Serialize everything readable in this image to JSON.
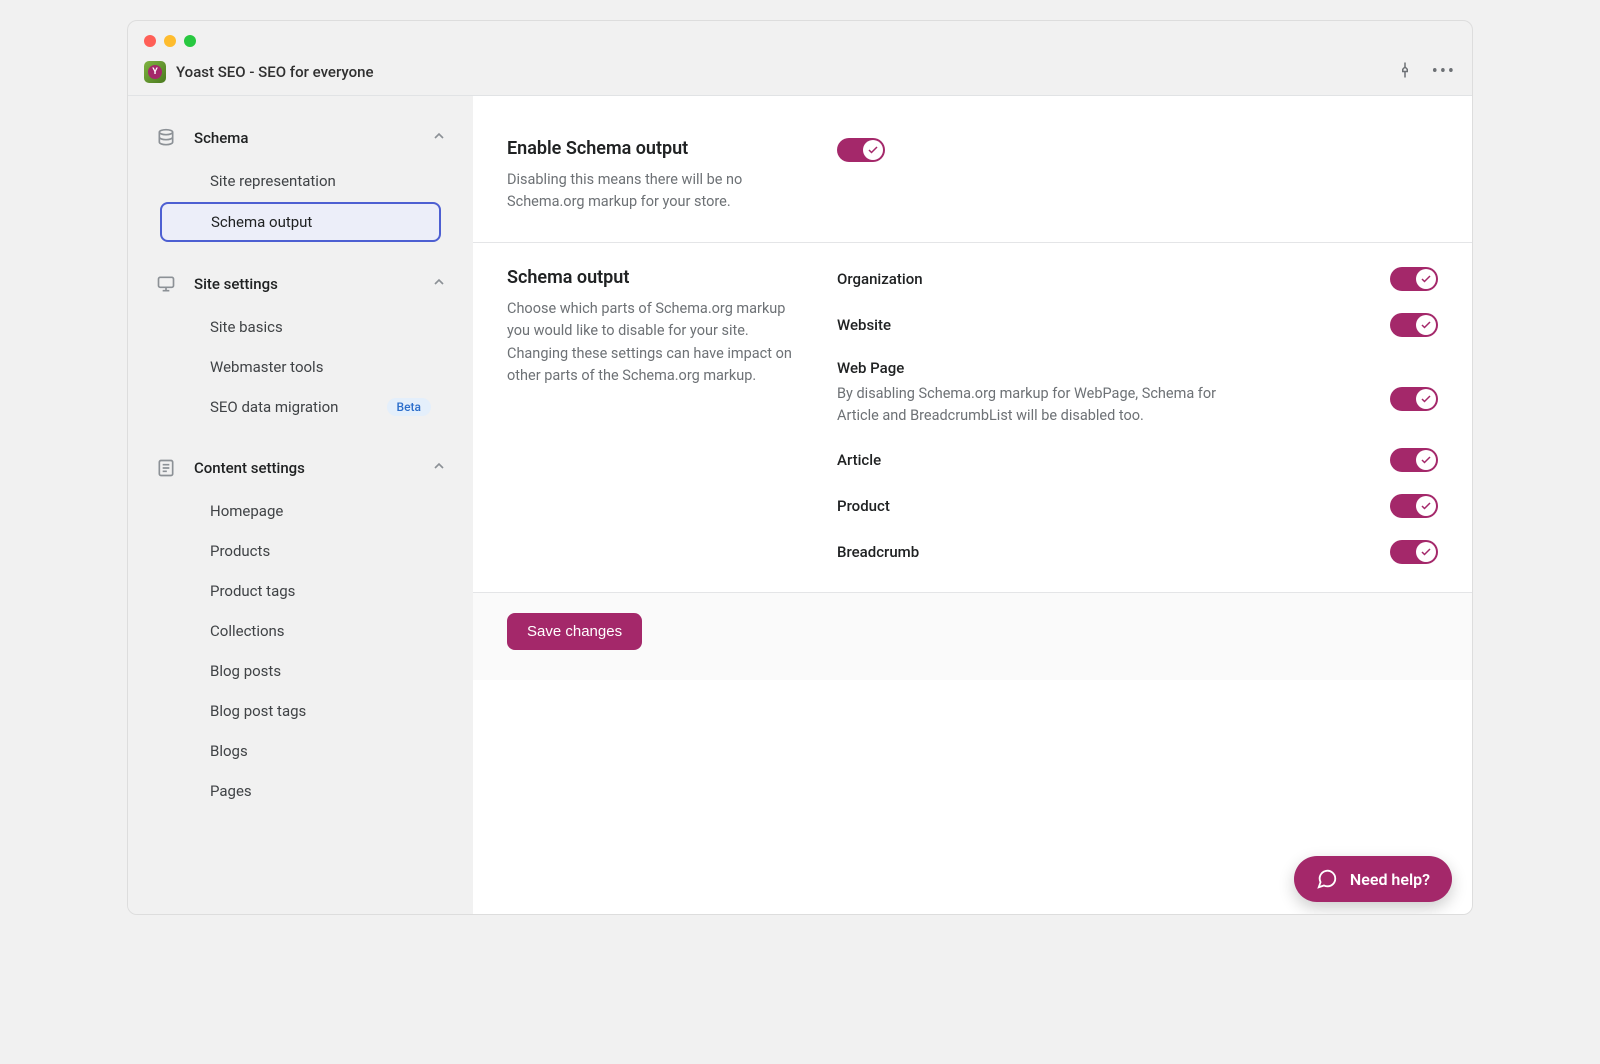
{
  "app": {
    "title": "Yoast SEO - SEO for everyone"
  },
  "sidebar": {
    "groups": [
      {
        "label": "Schema",
        "items": [
          {
            "label": "Site representation"
          },
          {
            "label": "Schema output",
            "active": true
          }
        ]
      },
      {
        "label": "Site settings",
        "items": [
          {
            "label": "Site basics"
          },
          {
            "label": "Webmaster tools"
          },
          {
            "label": "SEO data migration",
            "badge": "Beta"
          }
        ]
      },
      {
        "label": "Content settings",
        "items": [
          {
            "label": "Homepage"
          },
          {
            "label": "Products"
          },
          {
            "label": "Product tags"
          },
          {
            "label": "Collections"
          },
          {
            "label": "Blog posts"
          },
          {
            "label": "Blog post tags"
          },
          {
            "label": "Blogs"
          },
          {
            "label": "Pages"
          }
        ]
      }
    ]
  },
  "enable_section": {
    "title": "Enable Schema output",
    "desc": "Disabling this means there will be no Schema.org markup for your store."
  },
  "output_section": {
    "title": "Schema output",
    "desc": "Choose which parts of Schema.org markup you would like to disable for your site. Changing these settings can have impact on other parts of the Schema.org markup.",
    "toggles": [
      {
        "label": "Organization"
      },
      {
        "label": "Website"
      },
      {
        "label": "Web Page",
        "sub": "By disabling Schema.org markup for WebPage, Schema for Article and BreadcrumbList will be disabled too."
      },
      {
        "label": "Article"
      },
      {
        "label": "Product"
      },
      {
        "label": "Breadcrumb"
      }
    ]
  },
  "footer": {
    "save": "Save changes"
  },
  "help": {
    "label": "Need help?"
  }
}
